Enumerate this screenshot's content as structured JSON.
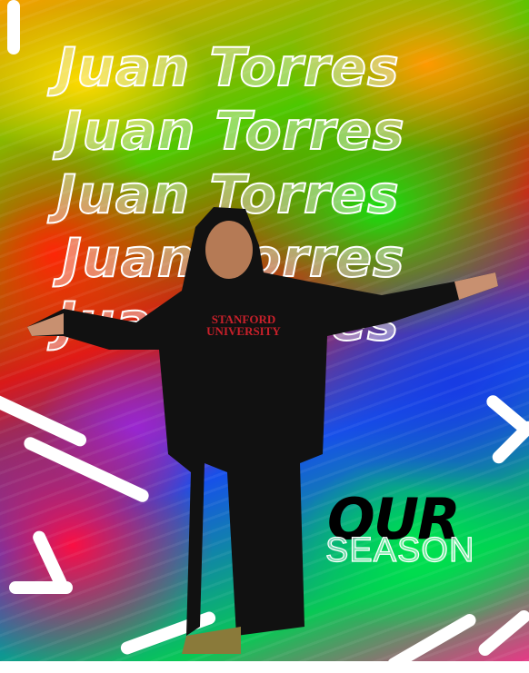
{
  "poster": {
    "headline_lines": [
      "Juan Torres",
      "Juan Torres",
      "Juan Torres",
      "Juan Torres",
      "Juan Torres"
    ],
    "title_bold": "OUR",
    "title_outline": "SEASON",
    "shirt_text": [
      "STANFORD",
      "UNIVERSITY"
    ]
  },
  "colors": {
    "text_outline": "#ffffff",
    "title_bold": "#000000",
    "shirt_print": "#c8202a"
  }
}
